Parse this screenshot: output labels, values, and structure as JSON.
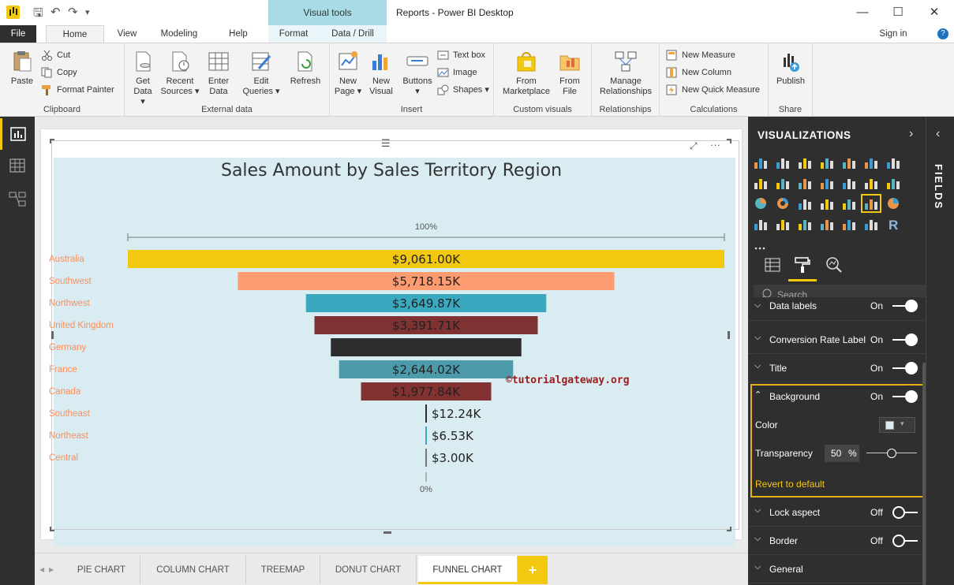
{
  "titlebar": {
    "context_tab": "Visual tools",
    "title": "Reports - Power BI Desktop",
    "minimize": "—",
    "maximize": "☐",
    "close": "✕"
  },
  "tabs": {
    "file": "File",
    "home": "Home",
    "view": "View",
    "modeling": "Modeling",
    "help": "Help",
    "format": "Format",
    "data_drill": "Data / Drill",
    "sign_in": "Sign in",
    "help_glyph": "?"
  },
  "ribbon": {
    "paste": "Paste",
    "cut": "Cut",
    "copy": "Copy",
    "format_painter": "Format Painter",
    "clipboard": "Clipboard",
    "get_data_1": "Get",
    "get_data_2": "Data ▾",
    "recent_1": "Recent",
    "recent_2": "Sources ▾",
    "enter_1": "Enter",
    "enter_2": "Data",
    "edit_1": "Edit",
    "edit_2": "Queries ▾",
    "refresh": "Refresh",
    "external_data": "External data",
    "new_page_1": "New",
    "new_page_2": "Page ▾",
    "new_visual_1": "New",
    "new_visual_2": "Visual",
    "buttons": "Buttons",
    "buttons_dd": "▾",
    "text_box": "Text box",
    "image": "Image",
    "shapes": "Shapes ▾",
    "insert": "Insert",
    "from_market_1": "From",
    "from_market_2": "Marketplace",
    "from_file_1": "From",
    "from_file_2": "File",
    "custom_visuals": "Custom visuals",
    "manage_rel_1": "Manage",
    "manage_rel_2": "Relationships",
    "relationships": "Relationships",
    "new_measure": "New Measure",
    "new_column": "New Column",
    "new_quick_measure": "New Quick Measure",
    "calculations": "Calculations",
    "publish": "Publish",
    "share": "Share"
  },
  "chart_data": {
    "type": "funnel",
    "title": "Sales Amount by Sales Territory Region",
    "top_percent_label": "100%",
    "bottom_percent_label": "0%",
    "max_value": 9061.0,
    "categories": [
      "Australia",
      "Southwest",
      "Northwest",
      "United Kingdom",
      "Germany",
      "France",
      "Canada",
      "Southeast",
      "Northeast",
      "Central"
    ],
    "values": [
      9061.0,
      5718.15,
      3649.87,
      3391.71,
      2894.31,
      2644.02,
      1977.84,
      12.24,
      6.53,
      3.0
    ],
    "labels": [
      "$9,061.00K",
      "$5,718.15K",
      "$3,649.87K",
      "$3,391.71K",
      "",
      "$2,644.02K",
      "$1,977.84K",
      "$12.24K",
      "$6.53K",
      "$3.00K"
    ],
    "colors": [
      "#f2c811",
      "#fd9b71",
      "#3aa8bf",
      "#7e3232",
      "#2d2d2d",
      "#4d9aab",
      "#833232",
      "#2d2d2d",
      "#3aa8bf",
      "#777777"
    ],
    "label_color": "#fd8e5b",
    "background": "#d9ecf1",
    "background_transparency_percent": 50
  },
  "watermark": "©tutorialgateway.org",
  "page_tabs": [
    "PIE CHART",
    "COLUMN CHART",
    "TREEMAP",
    "DONUT CHART",
    "FUNNEL CHART"
  ],
  "page_tab_add": "+",
  "viz_panel": {
    "title": "VISUALIZATIONS",
    "fields_label": "FIELDS",
    "search_placeholder": "Search",
    "sections": [
      {
        "label": "Data labels",
        "state": "On"
      },
      {
        "label": "Conversion Rate Label",
        "state": "On"
      },
      {
        "label": "Title",
        "state": "On"
      },
      {
        "label": "Background",
        "state": "On"
      },
      {
        "label": "Lock aspect",
        "state": "Off"
      },
      {
        "label": "Border",
        "state": "Off"
      },
      {
        "label": "General",
        "state": ""
      }
    ],
    "background": {
      "color_label": "Color",
      "transparency_label": "Transparency",
      "transparency_value": "50",
      "transparency_unit": "%",
      "revert_label": "Revert to default"
    }
  }
}
